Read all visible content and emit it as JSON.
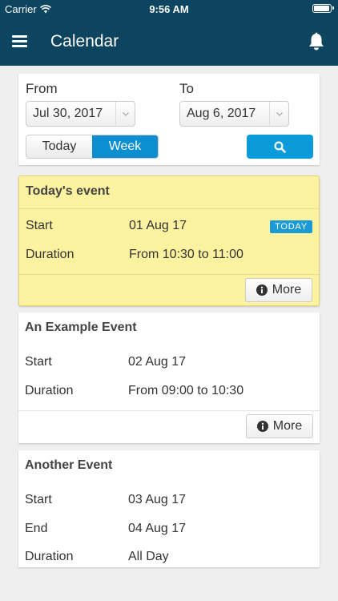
{
  "status": {
    "carrier": "Carrier",
    "time": "9:56 AM"
  },
  "nav": {
    "title": "Calendar"
  },
  "filter": {
    "from_label": "From",
    "from_value": "Jul 30, 2017",
    "to_label": "To",
    "to_value": "Aug 6, 2017",
    "today_label": "Today",
    "week_label": "Week"
  },
  "events": [
    {
      "title": "Today's event",
      "rows": [
        {
          "label": "Start",
          "value": "01 Aug 17"
        },
        {
          "label": "Duration",
          "value": "From 10:30 to 11:00"
        }
      ],
      "badge": "TODAY",
      "more_label": "More"
    },
    {
      "title": "An Example Event",
      "rows": [
        {
          "label": "Start",
          "value": "02 Aug 17"
        },
        {
          "label": "Duration",
          "value": "From 09:00 to 10:30"
        }
      ],
      "more_label": "More"
    },
    {
      "title": "Another Event",
      "rows": [
        {
          "label": "Start",
          "value": "03 Aug 17"
        },
        {
          "label": "End",
          "value": "04 Aug 17"
        },
        {
          "label": "Duration",
          "value": "All Day"
        }
      ]
    }
  ],
  "colors": {
    "nav_bg": "#0d4560",
    "accent": "#0b9bdb",
    "highlight_bg": "#fcf29f"
  },
  "icons": [
    "wifi-icon",
    "battery-icon",
    "menu-icon",
    "bell-icon",
    "search-icon",
    "info-icon",
    "chevron-down-icon"
  ]
}
